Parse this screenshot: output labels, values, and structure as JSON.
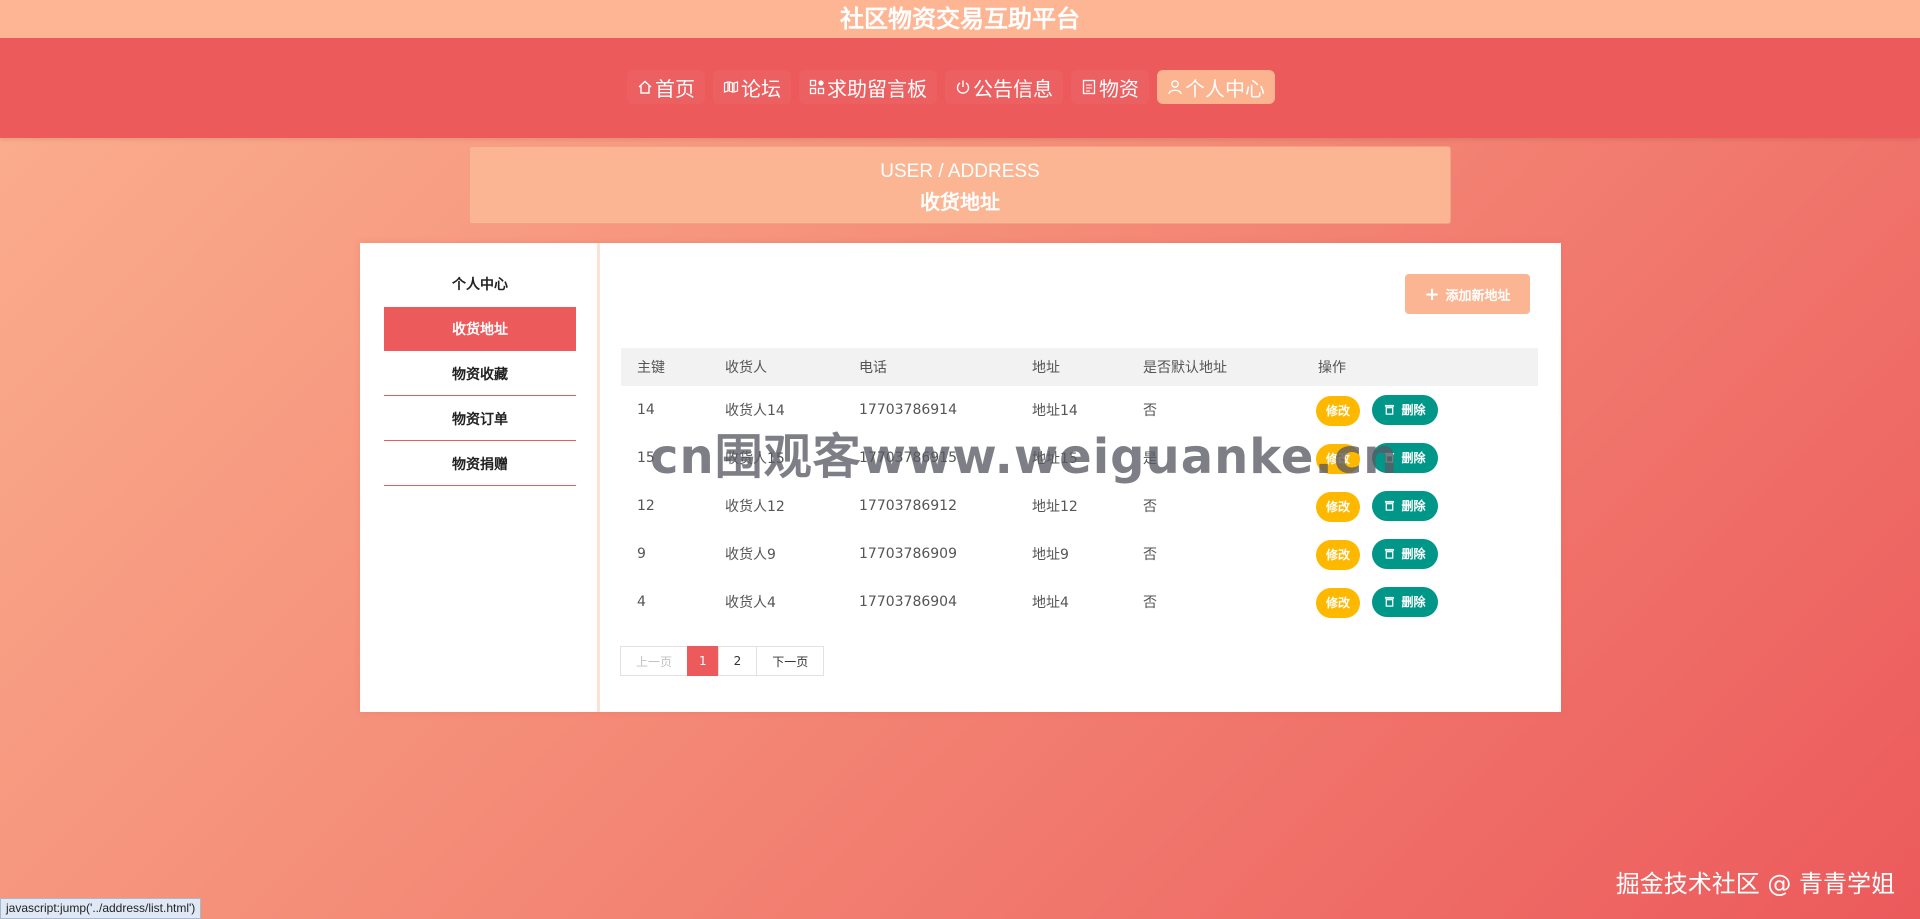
{
  "app": {
    "title": "社区物资交易互助平台"
  },
  "nav": {
    "items": [
      {
        "label": "首页",
        "icon": "home-icon"
      },
      {
        "label": "论坛",
        "icon": "forum-icon"
      },
      {
        "label": "求助留言板",
        "icon": "grid-icon"
      },
      {
        "label": "公告信息",
        "icon": "power-icon"
      },
      {
        "label": "物资",
        "icon": "document-icon"
      },
      {
        "label": "个人中心",
        "icon": "user-icon",
        "active": true
      }
    ]
  },
  "header": {
    "en": "USER / ADDRESS",
    "zh": "收货地址"
  },
  "sidebar": {
    "items": [
      {
        "label": "个人中心"
      },
      {
        "label": "收货地址",
        "active": true
      },
      {
        "label": "物资收藏"
      },
      {
        "label": "物资订单"
      },
      {
        "label": "物资捐赠"
      }
    ]
  },
  "toolbar": {
    "add_label": "添加新地址",
    "add_icon": "plus-icon"
  },
  "table": {
    "columns": [
      "主键",
      "收货人",
      "电话",
      "地址",
      "是否默认地址",
      "操作"
    ],
    "rows": [
      {
        "id": "14",
        "name": "收货人14",
        "phone": "17703786914",
        "address": "地址14",
        "default": "否"
      },
      {
        "id": "15",
        "name": "收货人15",
        "phone": "17703786915",
        "address": "地址15",
        "default": "是"
      },
      {
        "id": "12",
        "name": "收货人12",
        "phone": "17703786912",
        "address": "地址12",
        "default": "否"
      },
      {
        "id": "9",
        "name": "收货人9",
        "phone": "17703786909",
        "address": "地址9",
        "default": "否"
      },
      {
        "id": "4",
        "name": "收货人4",
        "phone": "17703786904",
        "address": "地址4",
        "default": "否"
      }
    ],
    "edit_label": "修改",
    "delete_label": "删除",
    "delete_icon": "trash-icon"
  },
  "pagination": {
    "prev": "上一页",
    "pages": [
      "1",
      "2"
    ],
    "current": "1",
    "next": "下一页"
  },
  "overlay": {
    "watermark": "cn围观客www.weiguanke.cn",
    "credit": "掘金技术社区 @ 青青学姐"
  },
  "status_bar": {
    "link": "javascript:jump('../address/list.html')"
  },
  "colors": {
    "primary": "#ec5a5c",
    "light": "#fcb592",
    "edit": "#ffb800",
    "delete": "#009688"
  }
}
